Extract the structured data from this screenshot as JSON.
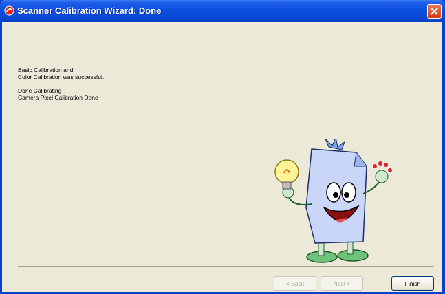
{
  "window": {
    "title": "Scanner Calibration Wizard: Done",
    "icon": "scanner-app-icon",
    "close_icon": "close-icon"
  },
  "message": {
    "line1": "Basic Calibration and",
    "line2": "Color Calibration was successful.",
    "line3": "Done Calibrating",
    "line4": "Camera Pixel Calibration Done"
  },
  "illustration": "document-mascot-with-lightbulb",
  "buttons": {
    "back": "< Back",
    "next": "Next >",
    "finish": "Finish"
  },
  "colors": {
    "titlebar": "#0a48d3",
    "client_bg": "#ece9d8",
    "close_btn": "#d9461f"
  }
}
